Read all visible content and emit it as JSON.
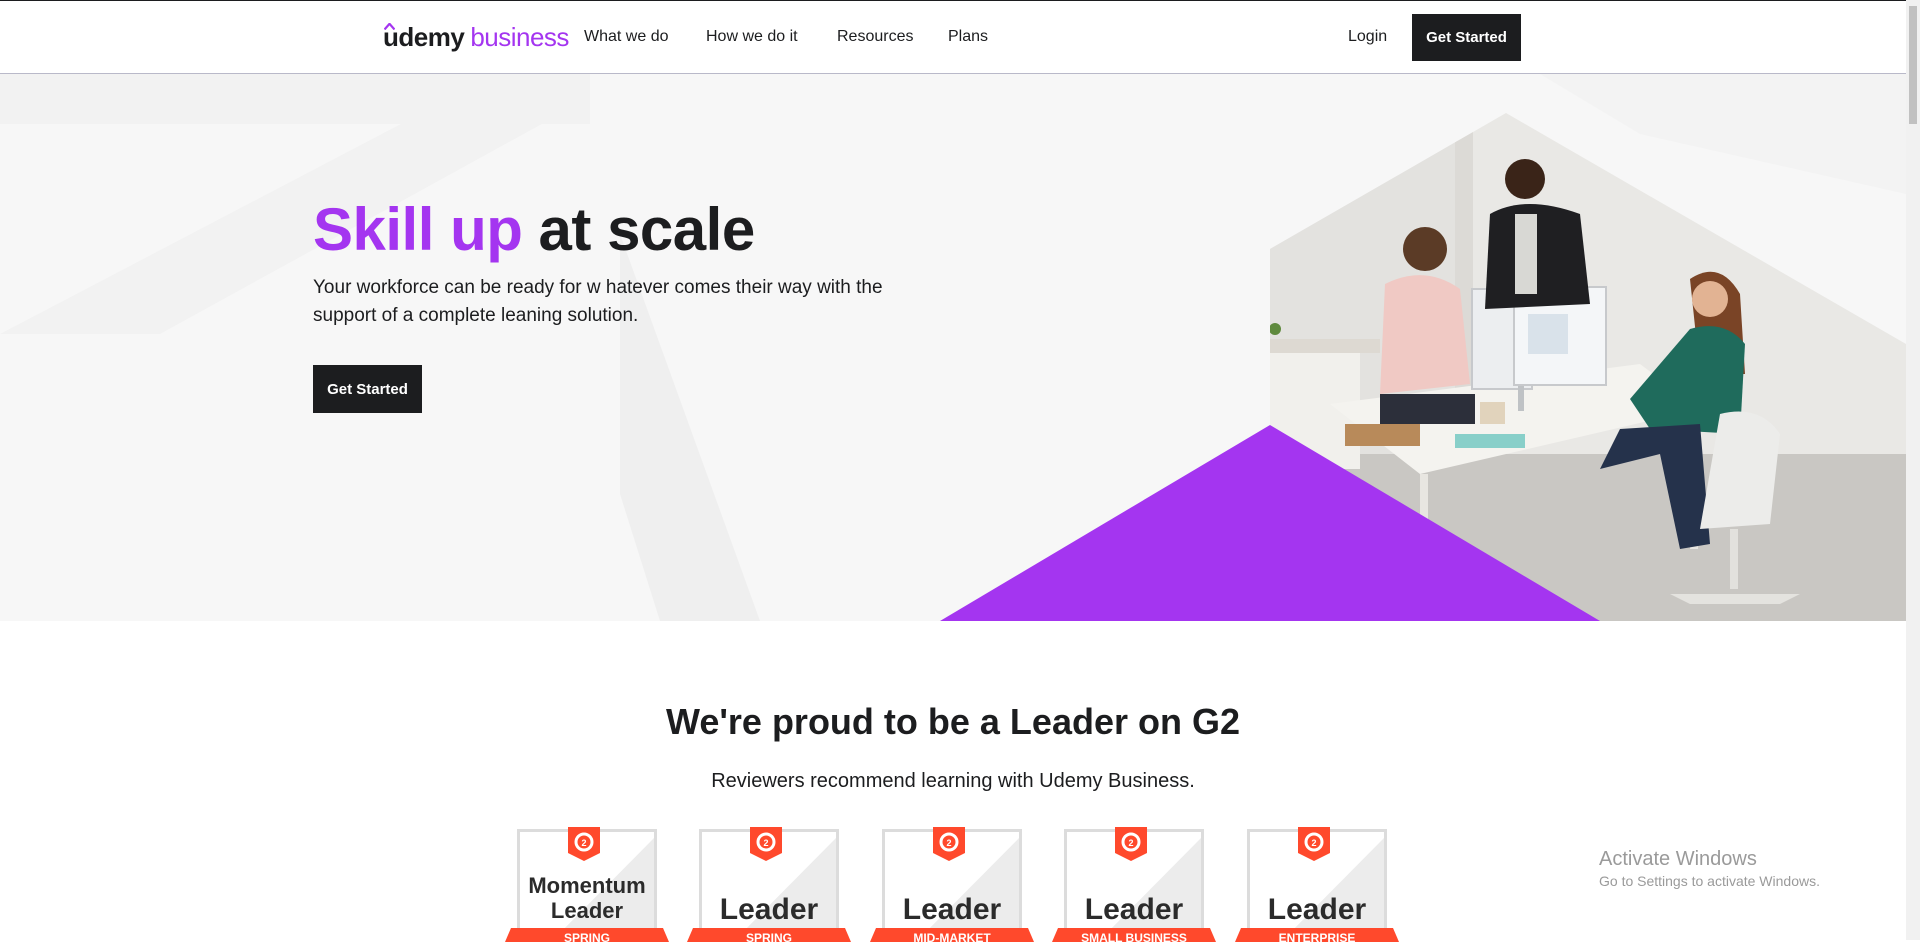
{
  "header": {
    "logo": {
      "brand": "udemy",
      "product": "business"
    },
    "nav": [
      "What we do",
      "How we do it",
      "Resources",
      "Plans"
    ],
    "login_label": "Login",
    "cta_label": "Get Started"
  },
  "hero": {
    "title_accent": "Skill up",
    "title_rest": "at scale",
    "subtitle": "Your workforce can be ready for w hatever comes their way with the support of a complete leaning solution.",
    "cta_label": "Get Started",
    "colors": {
      "accent": "#a435f0",
      "dark": "#1c1d1f",
      "background": "#f7f7f7"
    }
  },
  "g2": {
    "title": "We're proud to be a Leader on G2",
    "subtitle": "Reviewers recommend learning with Udemy Business.",
    "badges": [
      {
        "title_line1": "Momentum",
        "title_line2": "Leader",
        "ribbon": "SPRING"
      },
      {
        "title_line1": "Leader",
        "title_line2": "",
        "ribbon": "SPRING"
      },
      {
        "title_line1": "Leader",
        "title_line2": "",
        "ribbon": "Mid-Market"
      },
      {
        "title_line1": "Leader",
        "title_line2": "",
        "ribbon": "Small Business"
      },
      {
        "title_line1": "Leader",
        "title_line2": "",
        "ribbon": "Enterprise"
      }
    ],
    "colors": {
      "g2_red": "#ff492c"
    }
  },
  "watermark": {
    "line1": "Activate Windows",
    "line2": "Go to Settings to activate Windows."
  }
}
